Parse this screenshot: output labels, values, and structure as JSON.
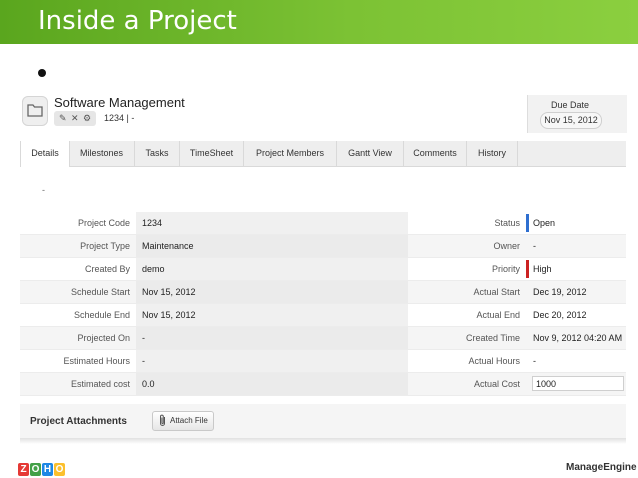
{
  "slide": {
    "title": "Inside a Project"
  },
  "project": {
    "name": "Software Management",
    "code_line": "1234  |  -",
    "tools": [
      "✎",
      "✕",
      "⚙"
    ],
    "due_date_label": "Due Date",
    "due_date_value": "Nov 15, 2012"
  },
  "tabs": [
    {
      "label": "Details",
      "active": true
    },
    {
      "label": "Milestones"
    },
    {
      "label": "Tasks"
    },
    {
      "label": "TimeSheet"
    },
    {
      "label": "Project Members"
    },
    {
      "label": "Gantt View"
    },
    {
      "label": "Comments"
    },
    {
      "label": "History"
    }
  ],
  "description_placeholder": "-",
  "details": {
    "left": [
      {
        "label": "Project Code",
        "value": "1234"
      },
      {
        "label": "Project Type",
        "value": "Maintenance"
      },
      {
        "label": "Created By",
        "value": "demo"
      },
      {
        "label": "Schedule Start",
        "value": "Nov 15, 2012"
      },
      {
        "label": "Schedule End",
        "value": "Nov 15, 2012"
      },
      {
        "label": "Projected On",
        "value": "-"
      },
      {
        "label": "Estimated Hours",
        "value": "-"
      },
      {
        "label": "Estimated cost",
        "value": "0.0"
      }
    ],
    "right": [
      {
        "label": "Status",
        "value": "Open",
        "marker_color": "#2f6fd0"
      },
      {
        "label": "Owner",
        "value": "-"
      },
      {
        "label": "Priority",
        "value": "High",
        "marker_color": "#cc2222"
      },
      {
        "label": "Actual Start",
        "value": "Dec 19, 2012"
      },
      {
        "label": "Actual End",
        "value": "Dec 20, 2012"
      },
      {
        "label": "Created Time",
        "value": "Nov 9, 2012 04:20 AM"
      },
      {
        "label": "Actual Hours",
        "value": "-"
      },
      {
        "label": "Actual Cost",
        "value": "1000"
      }
    ]
  },
  "attachments": {
    "title": "Project Attachments",
    "button_label": "Attach File"
  },
  "footer": {
    "zoho_letters": [
      "Z",
      "O",
      "H",
      "O"
    ],
    "zoho_colors": [
      "#e53935",
      "#43a047",
      "#1e88e5",
      "#fbc02d"
    ],
    "manageengine": "ManageEngine"
  },
  "colors": {
    "banner_green": "#7cc234",
    "status_open": "#2f6fd0",
    "priority_high": "#cc2222"
  }
}
